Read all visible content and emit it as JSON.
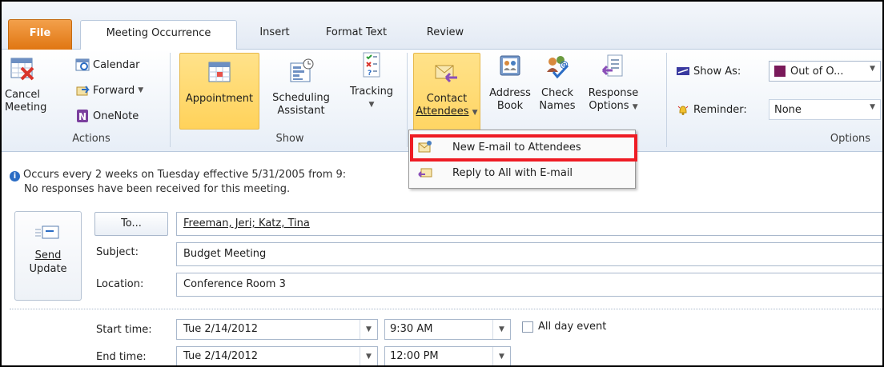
{
  "tabs": {
    "file": "File",
    "meeting_occurrence": "Meeting Occurrence",
    "insert": "Insert",
    "format_text": "Format Text",
    "review": "Review"
  },
  "ribbon": {
    "actions": {
      "label": "Actions",
      "cancel_line1": "Cancel",
      "cancel_line2": "Meeting",
      "calendar": "Calendar",
      "forward": "Forward",
      "onenote": "OneNote"
    },
    "show": {
      "label": "Show",
      "appointment": "Appointment",
      "scheduling_line1": "Scheduling",
      "scheduling_line2": "Assistant",
      "tracking": "Tracking"
    },
    "attendees": {
      "contact_line1": "Contact",
      "contact_line2": "Attendees",
      "address_line1": "Address",
      "address_line2": "Book",
      "check_line1": "Check",
      "check_line2": "Names",
      "response_line1": "Response",
      "response_line2": "Options"
    },
    "options": {
      "label": "Options",
      "show_as_label": "Show As:",
      "show_as_value": "Out of O...",
      "reminder_label": "Reminder:",
      "reminder_value": "None"
    }
  },
  "dropdown": {
    "new_email": "New E-mail to Attendees",
    "reply_all": "Reply to All with E-mail"
  },
  "info": {
    "line1": "Occurs every 2 weeks on Tuesday effective 5/31/2005 from 9:",
    "line2": "No responses have been received for this meeting."
  },
  "form": {
    "send_line1": "Send",
    "send_line2": "Update",
    "to_button": "To...",
    "to_value": "Freeman, Jeri; Katz, Tina",
    "subject_label": "Subject:",
    "subject_value": "Budget Meeting",
    "location_label": "Location:",
    "location_value": "Conference Room 3",
    "start_label": "Start time:",
    "start_date": "Tue 2/14/2012",
    "start_time": "9:30 AM",
    "end_label": "End time:",
    "end_date": "Tue 2/14/2012",
    "end_time": "12:00 PM",
    "all_day": "All day event"
  },
  "colors": {
    "file_tab": "#e07612",
    "highlight_button": "#ffd25a",
    "callout_red": "#ee1c24",
    "show_as_swatch": "#7a1a5a"
  }
}
